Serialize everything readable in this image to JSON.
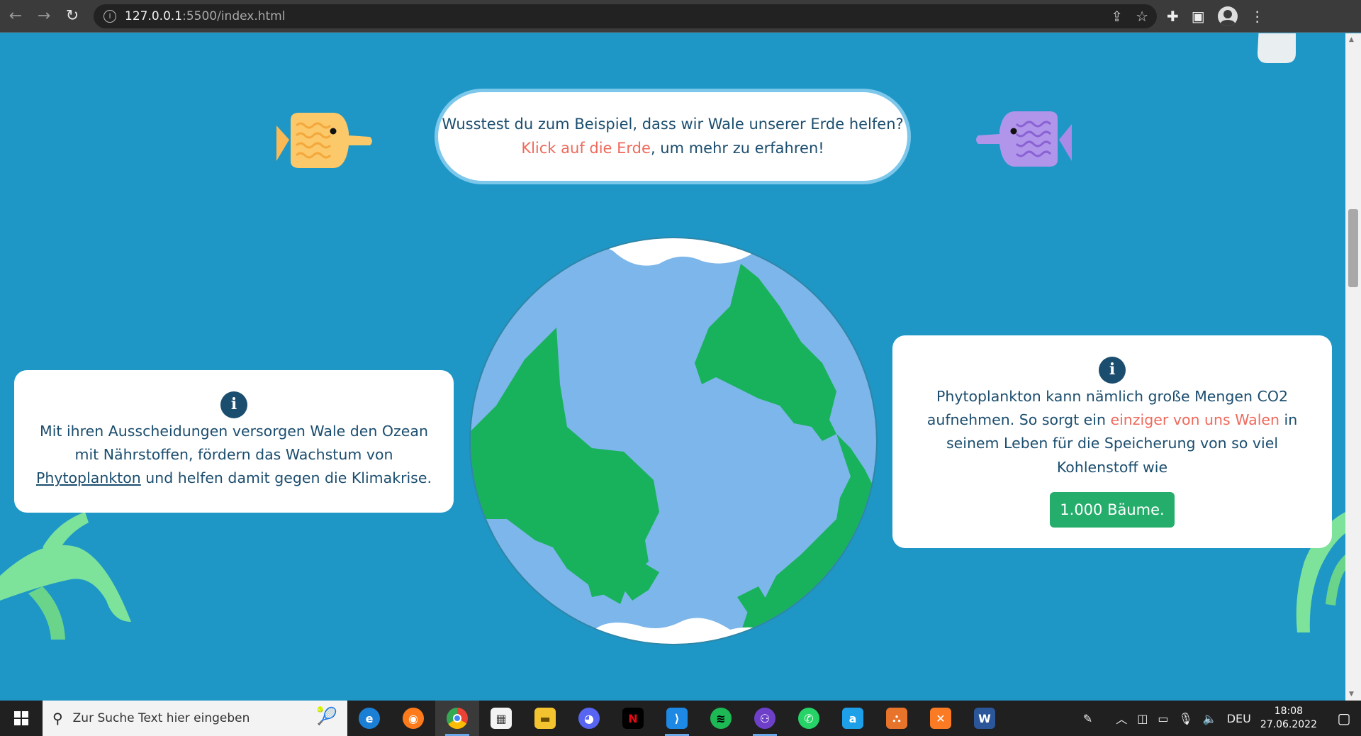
{
  "browser": {
    "url_host": "127.0.0.1",
    "url_path": ":5500/index.html",
    "back_icon": "arrow-left-icon",
    "forward_icon": "arrow-right-icon",
    "reload_icon": "reload-icon"
  },
  "speech": {
    "line1": "Wusstest du zum Beispiel, dass wir Wale unserer Erde helfen?",
    "line2_highlight": "Klick auf die Erde",
    "line2_rest": ", um mehr zu erfahren!"
  },
  "left_card": {
    "info_glyph": "i",
    "text_before": "Mit ihren Ausscheidungen versorgen Wale den Ozean mit Nährstoffen, fördern das Wachstum von ",
    "link_text": "Phytoplankton",
    "text_after": " und helfen damit gegen die Klimakrise."
  },
  "right_card": {
    "info_glyph": "i",
    "text_before": "Phytoplankton kann nämlich große Mengen CO2 aufnehmen. So sorgt ein ",
    "highlight": "einziger von uns Walen",
    "text_after": " in seinem Leben für die Speicherung von so viel Kohlenstoff wie",
    "badge": "1.000 Bäume."
  },
  "taskbar": {
    "search_placeholder": "Zur Suche Text hier eingeben",
    "language": "DEU",
    "time": "18:08",
    "date": "27.06.2022"
  },
  "colors": {
    "ocean": "#1e97c7",
    "text": "#1b4d6e",
    "accent_red": "#ee6a5c",
    "badge_green": "#25ad6b"
  }
}
